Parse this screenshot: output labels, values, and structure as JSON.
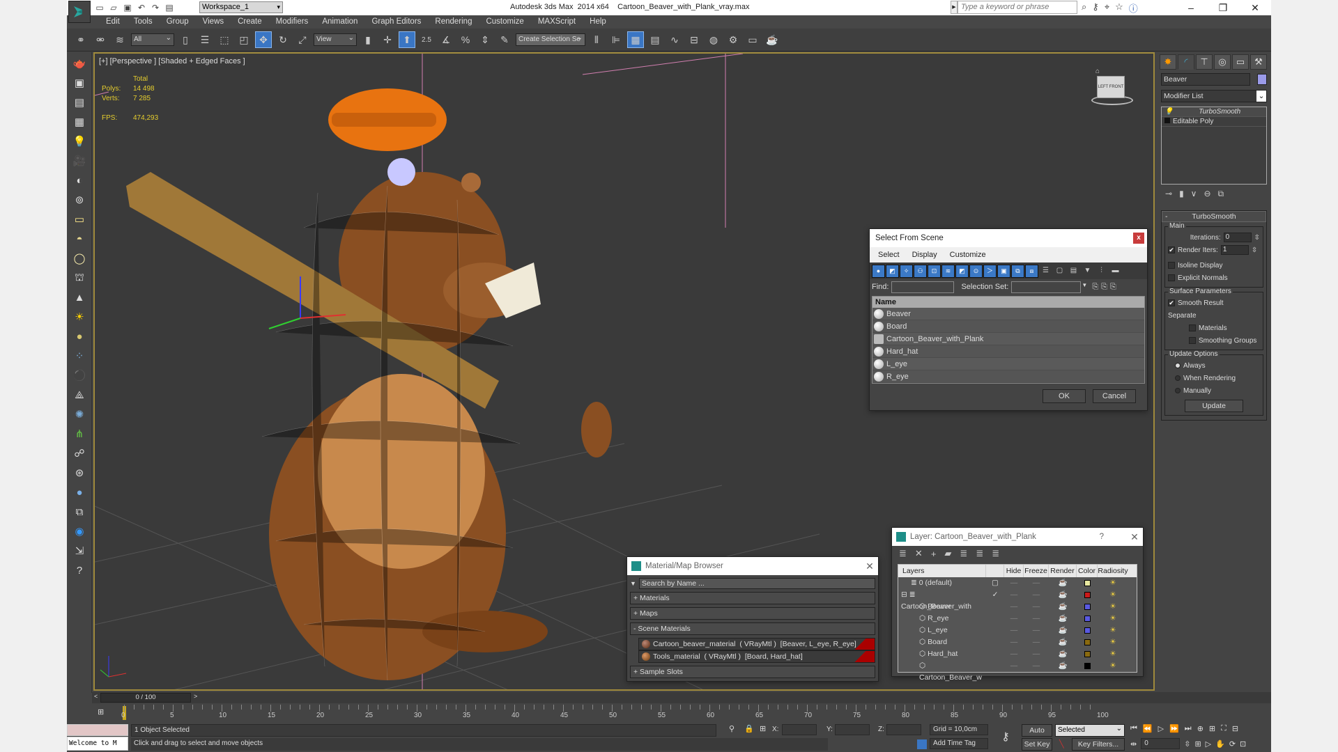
{
  "window": {
    "app_title": "Autodesk 3ds Max  2014 x64",
    "file_name": "Cartoon_Beaver_with_Plank_vray.max",
    "workspace": "Workspace_1",
    "search_placeholder": "Type a keyword or phrase"
  },
  "menu": [
    "Edit",
    "Tools",
    "Group",
    "Views",
    "Create",
    "Modifiers",
    "Animation",
    "Graph Editors",
    "Rendering",
    "Customize",
    "MAXScript",
    "Help"
  ],
  "toolbar": {
    "selection_filter": "All",
    "reference_coord": "View",
    "snap_angle": "2.5",
    "named_selection_placeholder": "Create Selection Se"
  },
  "viewport": {
    "label": "[+] [Perspective ] [Shaded + Edged Faces ]",
    "stats": {
      "total_label": "Total",
      "polys_label": "Polys:",
      "polys": "14 498",
      "verts_label": "Verts:",
      "verts": "7 285",
      "fps_label": "FPS:",
      "fps": "474,293"
    },
    "viewcube_left": "LEFT",
    "viewcube_front": "FRONT"
  },
  "command_panel": {
    "object_name": "Beaver",
    "object_color": "#9a9ae8",
    "modifier_list": "Modifier List",
    "stack": [
      "TurboSmooth",
      "Editable Poly"
    ],
    "rollout_title": "TurboSmooth",
    "main_group": "Main",
    "iterations_label": "Iterations:",
    "iterations": "0",
    "render_iters_label": "Render Iters:",
    "render_iters": "1",
    "isoline_label": "Isoline Display",
    "explicit_normals_label": "Explicit Normals",
    "surface_group": "Surface Parameters",
    "smooth_result_label": "Smooth Result",
    "separate_label": "Separate",
    "materials_label": "Materials",
    "smoothing_groups_label": "Smoothing Groups",
    "update_group": "Update Options",
    "always_label": "Always",
    "when_rendering_label": "When Rendering",
    "manually_label": "Manually",
    "update_button": "Update"
  },
  "select_from_scene": {
    "title": "Select From Scene",
    "menu": [
      "Select",
      "Display",
      "Customize"
    ],
    "find_label": "Find:",
    "selection_set_label": "Selection Set:",
    "column_name": "Name",
    "items": [
      "Beaver",
      "Board",
      "Cartoon_Beaver_with_Plank",
      "Hard_hat",
      "L_eye",
      "R_eye"
    ],
    "ok": "OK",
    "cancel": "Cancel"
  },
  "material_browser": {
    "title": "Material/Map Browser",
    "search_placeholder": "Search by Name ...",
    "sections": [
      "+ Materials",
      "+ Maps",
      "- Scene Materials"
    ],
    "materials": [
      "Cartoon_beaver_material  ( VRayMtl )  [Beaver, L_eye, R_eye]",
      "Tools_material  ( VRayMtl )  [Board, Hard_hat]"
    ],
    "sample_slots": "+ Sample Slots"
  },
  "layer_dialog": {
    "title": "Layer: Cartoon_Beaver_with_Plank",
    "help": "?",
    "columns": [
      "Layers",
      "",
      "Hide",
      "Freeze",
      "Render",
      "Color",
      "Radiosity"
    ],
    "rows": [
      {
        "name": "0 (default)",
        "color": "#e8e8a0",
        "indent": 1
      },
      {
        "name": "Cartoon_Beaver_with",
        "color": "#cc1a1a",
        "indent": 0
      },
      {
        "name": "Beaver",
        "color": "#5a5ae0",
        "indent": 2
      },
      {
        "name": "R_eye",
        "color": "#5a5ae0",
        "indent": 2
      },
      {
        "name": "L_eye",
        "color": "#5a5ae0",
        "indent": 2
      },
      {
        "name": "Board",
        "color": "#8a6a10",
        "indent": 2
      },
      {
        "name": "Hard_hat",
        "color": "#8a6a10",
        "indent": 2
      },
      {
        "name": "Cartoon_Beaver_w",
        "color": "#000000",
        "indent": 2
      }
    ]
  },
  "timeline": {
    "slider": "0 / 100",
    "ticks": [
      "0",
      "5",
      "10",
      "15",
      "20",
      "25",
      "30",
      "35",
      "40",
      "45",
      "50",
      "55",
      "60",
      "65",
      "70",
      "75",
      "80",
      "85",
      "90",
      "95",
      "100"
    ]
  },
  "status": {
    "selected": "1 Object Selected",
    "prompt": "Click and drag to select and move objects",
    "maxscript": "Welcome to M",
    "x_label": "X:",
    "y_label": "Y:",
    "z_label": "Z:",
    "grid": "Grid = 10,0cm",
    "add_time_tag": "Add Time Tag",
    "auto_key": "Auto Key",
    "set_key": "Set Key",
    "key_mode": "Selected",
    "key_filters": "Key Filters...",
    "frame": "0"
  },
  "colors": {
    "accent": "#3a76c4",
    "stats_yellow": "#e5cd2e",
    "viewport_border": "#a08a3c"
  }
}
